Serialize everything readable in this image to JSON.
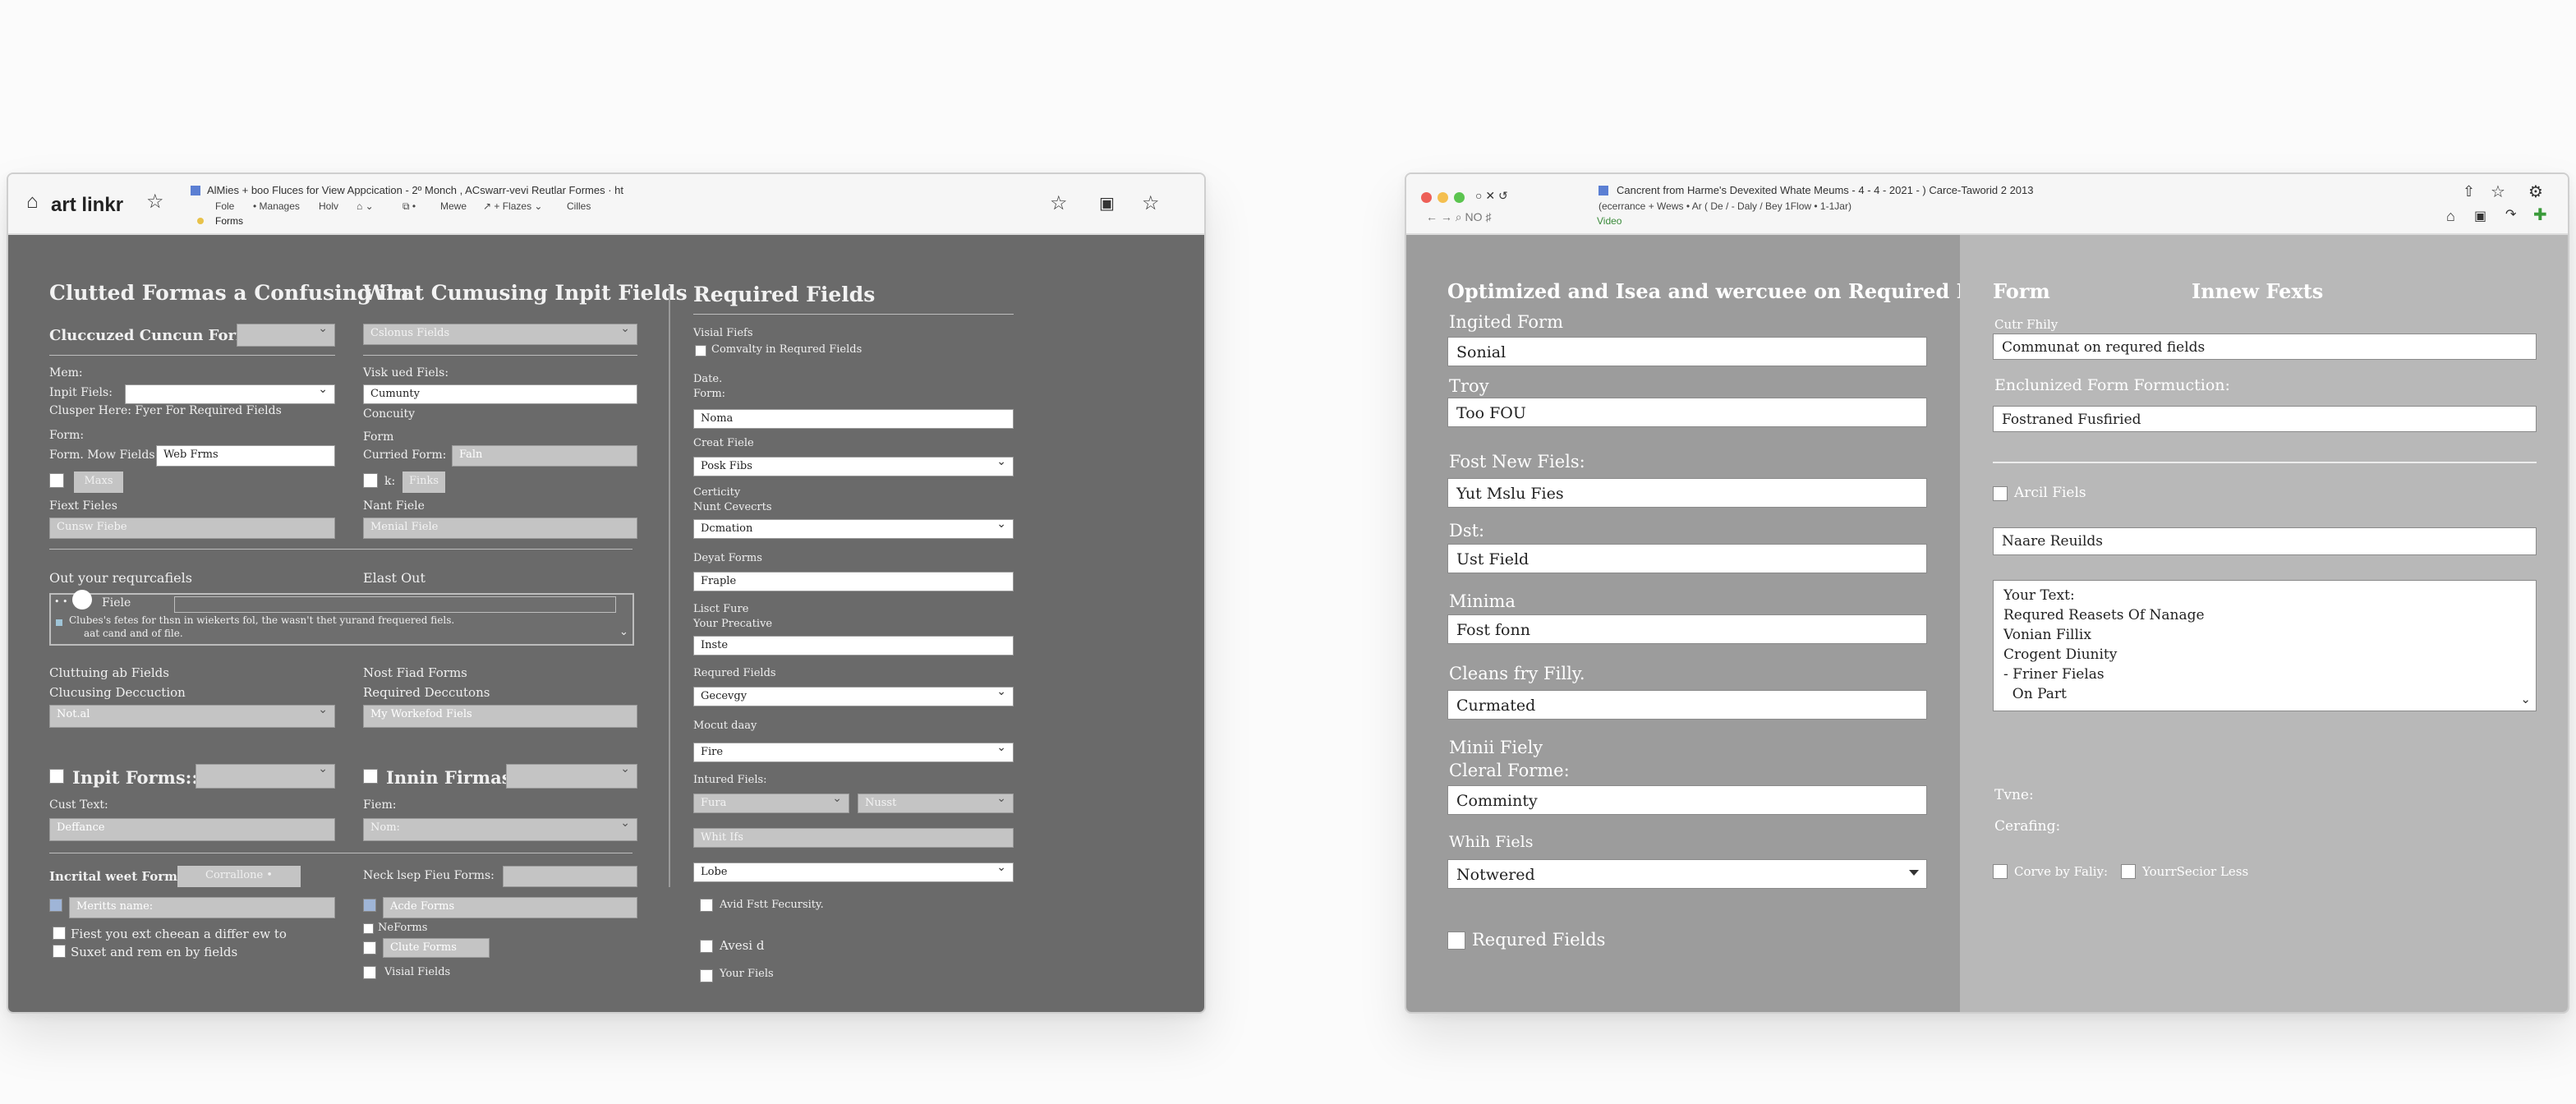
{
  "left_window": {
    "chrome": {
      "brand_text": "art  linkr",
      "title": "AlMies + boo Fluces for  View Appcication - 2º Monch , ACswarr-vevi Reutlar Formes · ht",
      "menu": [
        "Fole",
        "• Manages",
        "Holv",
        "⌂ ⌄",
        "⧉ •",
        "Mewe",
        "↗ + Flazes ⌄",
        "Cilles"
      ],
      "forms_label": "Forms"
    },
    "col1": {
      "title": "Clutted Formas a Confusing iin",
      "custom_form_label": "Cluccuzed Cuncun Form:",
      "mem_label": "Mem:",
      "input_fields_label": "Inpit Fiels:",
      "clusper_text": "Clusper Here: Fyer For Required Fields",
      "form_label": "Form:",
      "form_row_label": "Form. Mow Fields:",
      "form_row_value": "Web Frms",
      "maxs_button": "Maxs",
      "fexet_label": "Fiext Fieles",
      "fexet_value": "Cunsw Fiebe",
      "out_title": "Out your requrcafiels",
      "elast_out": "Elast Out",
      "field_tag": "Fiele",
      "note_text": "Clubes's fetes for thsn in wiekerts fol, the wasn't thet yurand frequered fiels.",
      "note_text_2": "aat cand and of file.",
      "cluttering_label": "Cluttuing ab Fields",
      "clucusing_label": "Clucusing Deccuction",
      "clucusing_value": "Not.al",
      "input_forms_label": "Inpit Forms::",
      "cust_text_label": "Cust Text:",
      "cust_text_value": "Deffance",
      "incrital_label": "Incrital weet Forms:",
      "incrital_value": "Corrallone •",
      "meritts_value": "Meritts name:",
      "check_1": "Fiest you ext cheean a differ ew to",
      "check_2": "Suxet and rem en by fields"
    },
    "col2": {
      "title": "What Cumusing Inpit Fields",
      "select_value": "Cslonus Fields",
      "visit_label": "Visk ued Fiels:",
      "visit_value": "Cumunty",
      "concuity_label": "Concuity",
      "form_label": "Form",
      "current_form_label": "Curried Form:",
      "current_form_value": "Faln",
      "k_label": "k:",
      "finks_button": "Finks",
      "nant_label": "Nant Fiele",
      "nant_value": "Menial Fiele",
      "nost_fiad": "Nost Fiad Forms",
      "required_dec": "Required Deccutons",
      "my_workefod": "My Workefod Fiels",
      "innin_label": "Innin Firmas:",
      "fiem_label": "Fiem:",
      "fiem_value": "Nom:",
      "neck_label": "Neck lsep Fieu Forms:",
      "acde_value": "Acde Forms",
      "neforms_label": "NeForms",
      "clute_value": "Clute Forms",
      "visial_label": "Visial Fields"
    },
    "col3": {
      "title": "Required Fields",
      "visial_label": "Visial Fiefs",
      "comvalty_label": "Comvalty in Requred Fields",
      "date_label": "Date.",
      "form_label": "Form:",
      "date_value": "Noma",
      "creat_label": "Creat Fiele",
      "creat_value": "Posk Fibs",
      "certicity_label": "Certicity",
      "nunt_label": "Nunt Cevecrts",
      "nunt_value": "Dcmation",
      "deyat_label": "Deyat Forms",
      "deyat_value": "Fraple",
      "lisct_label": "Lisct Fure",
      "your_prec_label": "Your Precative",
      "your_prec_value": "Inste",
      "requred_label": "Requred Fields",
      "requred_value": "Gecevgy",
      "mocut_label": "Mocut daay",
      "mocut_value": "Fire",
      "intured_label": "Intured Fiels:",
      "intured_a": "Fura",
      "intured_b": "Nusst",
      "white_value": "Whit Ifs",
      "lobe_value": "Lobe",
      "avid_label": "Avid Fstt Fecursity.",
      "avesid_label": "Avesi d",
      "your_fiels_label": "Your Fiels"
    }
  },
  "right_window": {
    "chrome": {
      "title": "Cancrent from Harme's Devexited Whate Meums - 4 - 4 - 2021 - ) Carce-Taworid 2 2013",
      "row2": "(ecerrance   + Wews • Ar  ( De /  - Daly / Bey  1Flow  • 1-1Jar)",
      "video_label": "Video"
    },
    "left_pane": {
      "title": "Optimized and Isea and wercuee on Required Fields",
      "fields": [
        {
          "label": "Ingited Form",
          "value": "Sonial"
        },
        {
          "label": "Troy",
          "value": "Too FOU"
        },
        {
          "label": "Fost New Fiels:",
          "value": "Yut Mslu Fies"
        },
        {
          "label": "Dst:",
          "value": "Ust Field"
        },
        {
          "label": "Minima",
          "value": "Fost fonn"
        },
        {
          "label": "Cleans fry Filly.",
          "value": "Curmated"
        }
      ],
      "minii_label": "Minii Fiely",
      "cleral_label": "Cleral Forme:",
      "cleral_value": "Comminty",
      "whih_label": "Whih Fiels",
      "whih_value": "Notwered",
      "requred_fields": "Requred Fields"
    },
    "right_pane": {
      "title_form": "Form",
      "title_innew": "Innew Fexts",
      "cutr_label": "Cutr Fhily",
      "cutr_value": "Communat on requred fields",
      "enclun_label": "Enclunized Form Formuction:",
      "enclun_value": "Fostraned Fusfiried",
      "arcil_label": "Arcil Fiels",
      "naare_value": "Naare Reuilds",
      "textarea_lines": [
        "Your Text:",
        "Requred Reasets Of Nanage",
        "Vonian Fillix",
        "Crogent Diunity",
        "- Friner Fielas",
        "  On Part"
      ],
      "tvne_label": "Tvne:",
      "cerafing_label": "Cerafing:",
      "check_1": "Corve by Faliy:",
      "check_2": "YourrSecior Less"
    }
  },
  "colors": {
    "left_bg": "#6a6a6a",
    "right_left_pane": "#9c9c9c",
    "right_right_pane": "#b8b8b8",
    "traffic_red": "#ed5f57",
    "traffic_yellow": "#f4bf4f",
    "traffic_green": "#5bc44f"
  }
}
